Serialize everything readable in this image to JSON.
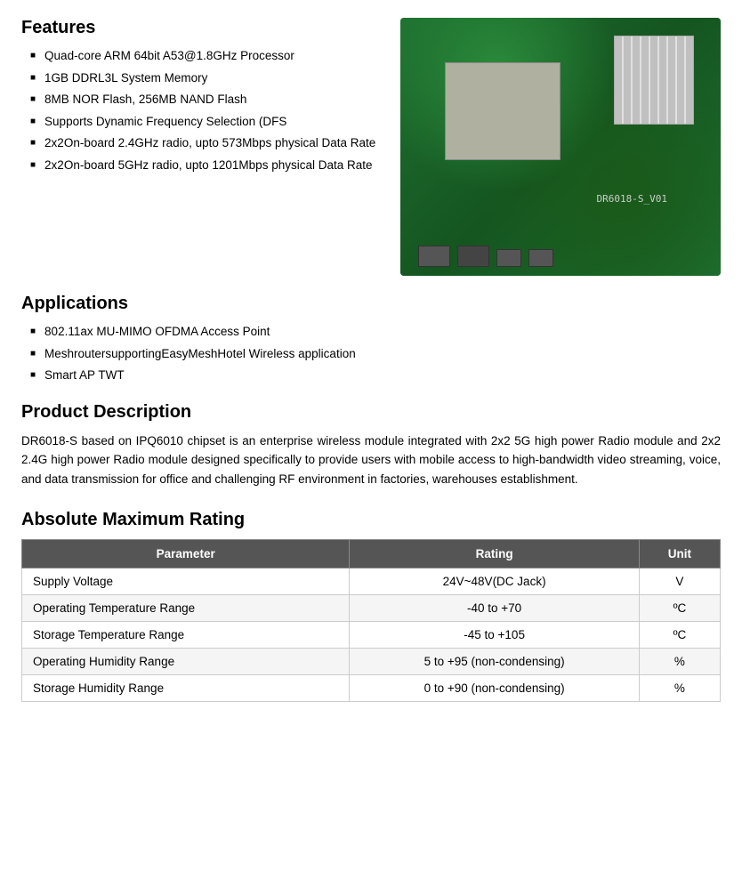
{
  "features": {
    "heading": "Features",
    "items": [
      "Quad-core ARM 64bit A53@1.8GHz Processor",
      "1GB DDRL3L System Memory",
      "8MB NOR Flash, 256MB NAND  Flash",
      "Supports Dynamic Frequency Selection (DFS",
      "2x2On-board 2.4GHz radio, upto 573Mbps physical Data Rate",
      "2x2On-board 5GHz radio, upto 1201Mbps physical Data Rate"
    ]
  },
  "board": {
    "label": "DR6018-S_V01"
  },
  "applications": {
    "heading": "Applications",
    "items": [
      "802.11ax MU-MIMO OFDMA Access Point",
      "MeshroutersupportingEasyMeshHotel Wireless application",
      "Smart AP TWT"
    ]
  },
  "product_description": {
    "heading": "Product Description",
    "text": "DR6018-S based on IPQ6010 chipset is an enterprise wireless module integrated with 2x2 5G high power Radio module and 2x2 2.4G high power Radio module designed specifically to provide users with mobile access to high-bandwidth video streaming, voice, and data transmission for office and challenging RF environment in factories, warehouses establishment."
  },
  "absolute_max_rating": {
    "heading": "Absolute Maximum Rating",
    "columns": [
      "Parameter",
      "Rating",
      "Unit"
    ],
    "rows": [
      [
        "Supply Voltage",
        "24V~48V(DC Jack)",
        "V"
      ],
      [
        "Operating Temperature Range",
        "-40 to +70",
        "ºC"
      ],
      [
        "Storage Temperature Range",
        "-45 to +105",
        "ºC"
      ],
      [
        "Operating Humidity Range",
        "5 to +95 (non-condensing)",
        "%"
      ],
      [
        "Storage Humidity Range",
        "0 to +90 (non-condensing)",
        "%"
      ]
    ]
  }
}
